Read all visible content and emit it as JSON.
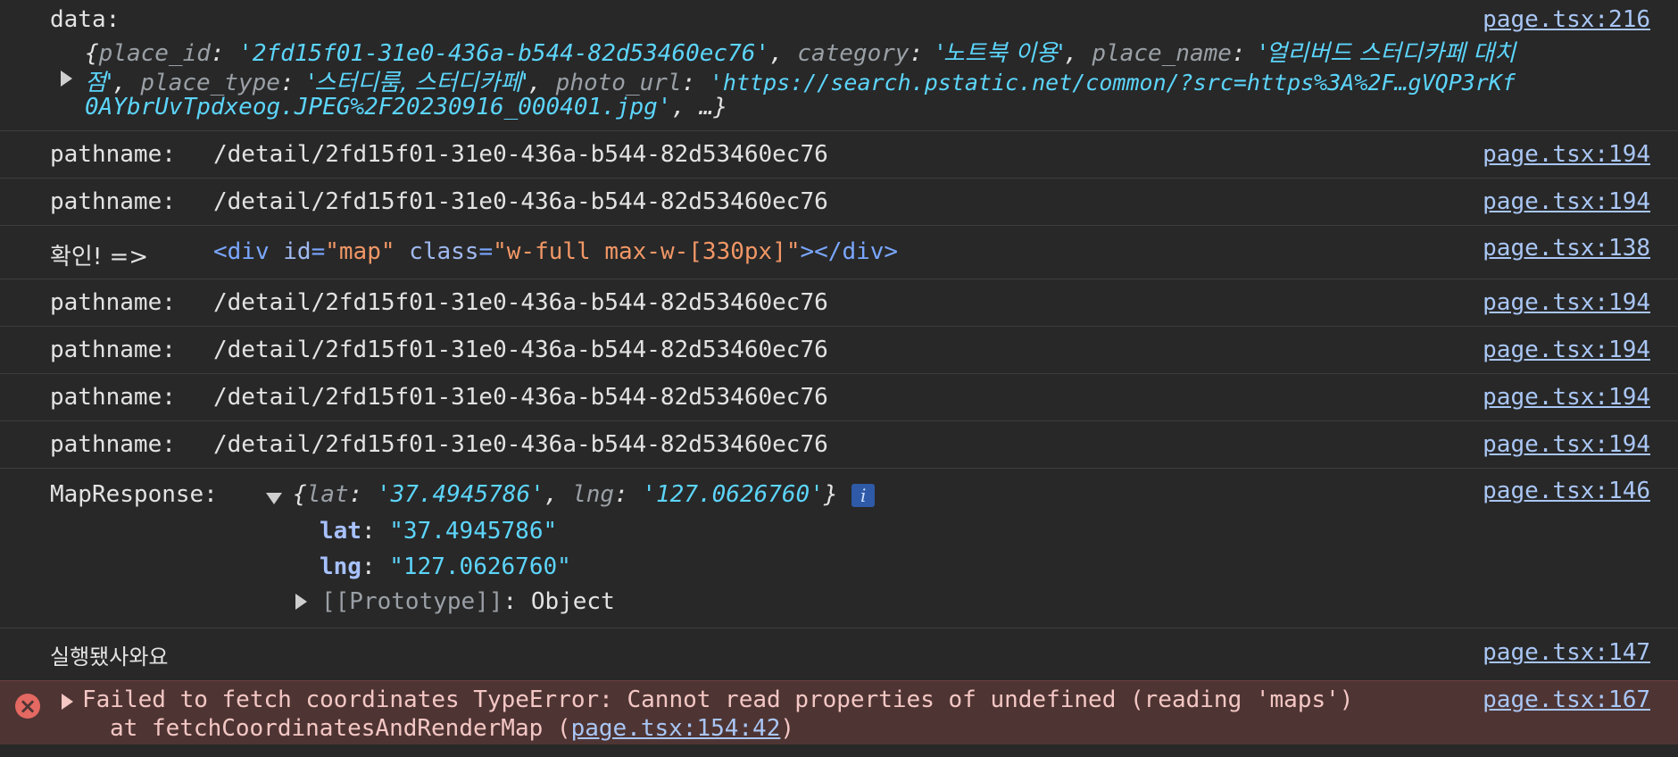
{
  "colors": {
    "background": "#282828",
    "string": "#5cd5fb",
    "link": "#a9c6f5",
    "error_bg": "#4e3534",
    "error_icon": "#e46962"
  },
  "entries": {
    "data": {
      "label": "data:",
      "source": "page.tsx:216",
      "line1_open": "{",
      "place_id_key": "place_id",
      "place_id_val": "'2fd15f01-31e0-436a-b544-82d53460ec76'",
      "category_key": "category",
      "category_val": "'노트북 이용'",
      "place_name_key": "place_name",
      "place_name_val_a": "'얼리버드 스터디카페 대치",
      "place_name_val_b": "점'",
      "place_type_key": "place_type",
      "place_type_val": "'스터디룸, 스터디카페'",
      "photo_url_key": "photo_url",
      "photo_url_val_a": "'https://search.pstatic.net/common/?src=https%3A%2F…gVQP3rKf",
      "photo_url_val_b": "0AYbrUvTpdxeog.JPEG%2F20230916_000401.jpg'",
      "tail": ", …}"
    },
    "pathname_label": "pathname:",
    "pathname_value": "/detail/2fd15f01-31e0-436a-b544-82d53460ec76",
    "pathname_source": "page.tsx:194",
    "confirm": {
      "label": "확인! =>",
      "tag_open": "<div",
      "id_attr": "id",
      "id_val": "\"map\"",
      "class_attr": "class",
      "class_val": "\"w-full max-w-[330px]\"",
      "tag_close": "></div>",
      "source": "page.tsx:138"
    },
    "map_response": {
      "label": "MapResponse:",
      "summary_lat_key": "lat",
      "summary_lat_val": "'37.4945786'",
      "summary_lng_key": "lng",
      "summary_lng_val": "'127.0626760'",
      "info_badge": "i",
      "lat_key": "lat",
      "lat_val": "\"37.4945786\"",
      "lng_key": "lng",
      "lng_val": "\"127.0626760\"",
      "proto_key": "[[Prototype]]",
      "proto_val": "Object",
      "source": "page.tsx:146"
    },
    "executed": {
      "text": "실행됐사와요",
      "source": "page.tsx:147"
    },
    "error": {
      "icon": "×",
      "message": "Failed to fetch coordinates TypeError: Cannot read properties of undefined (reading 'maps')",
      "stack_prefix": "at fetchCoordinatesAndRenderMap (",
      "stack_link": "page.tsx:154:42",
      "stack_suffix": ")",
      "source": "page.tsx:167"
    }
  }
}
